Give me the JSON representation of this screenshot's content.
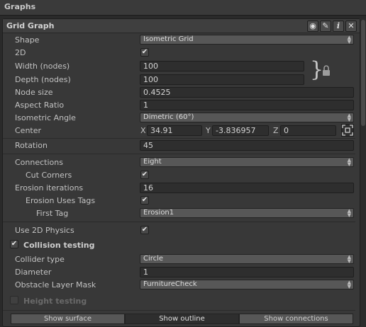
{
  "section_title": "Graphs",
  "graph": {
    "title": "Grid Graph",
    "header_icons": [
      "eye-icon",
      "pencil-icon",
      "info-icon",
      "close-icon"
    ],
    "info_glyph": "i",
    "close_glyph": "✕",
    "pencil_glyph": "✎",
    "eye_glyph": "◉"
  },
  "fields": {
    "shape": {
      "label": "Shape",
      "value": "Isometric Grid"
    },
    "two_d": {
      "label": "2D",
      "checked": true
    },
    "width": {
      "label": "Width (nodes)",
      "value": "100"
    },
    "depth": {
      "label": "Depth (nodes)",
      "value": "100"
    },
    "node_size": {
      "label": "Node size",
      "value": "0.4525"
    },
    "aspect_ratio": {
      "label": "Aspect Ratio",
      "value": "1"
    },
    "isometric_angle": {
      "label": "Isometric Angle",
      "value": "Dimetric (60°)"
    },
    "center": {
      "label": "Center",
      "x_label": "X",
      "x": "34.91",
      "y_label": "Y",
      "y": "-3.836957",
      "z_label": "Z",
      "z": "0"
    },
    "rotation": {
      "label": "Rotation",
      "value": "45"
    },
    "connections": {
      "label": "Connections",
      "value": "Eight"
    },
    "cut_corners": {
      "label": "Cut Corners",
      "checked": true
    },
    "erosion_iterations": {
      "label": "Erosion iterations",
      "value": "16"
    },
    "erosion_uses_tags": {
      "label": "Erosion Uses Tags",
      "checked": true
    },
    "first_tag": {
      "label": "First Tag",
      "value": "Erosion1"
    },
    "use_2d_physics": {
      "label": "Use 2D Physics",
      "checked": true
    },
    "collision_testing": {
      "label": "Collision testing",
      "checked": true
    },
    "collider_type": {
      "label": "Collider type",
      "value": "Circle"
    },
    "diameter": {
      "label": "Diameter",
      "value": "1"
    },
    "obstacle_layer_mask": {
      "label": "Obstacle Layer Mask",
      "value": "FurnitureCheck"
    },
    "height_testing": {
      "label": "Height testing",
      "checked": false
    }
  },
  "check_glyph": "✔",
  "dropdown_arrows": "▲▼",
  "bottom_buttons": {
    "show_surface": "Show surface",
    "show_outline": "Show outline",
    "show_connections": "Show connections"
  },
  "colors": {
    "panel": "#383838",
    "field": "#2e2e2e",
    "dropdown": "#575757",
    "text": "#c4c4c4"
  }
}
